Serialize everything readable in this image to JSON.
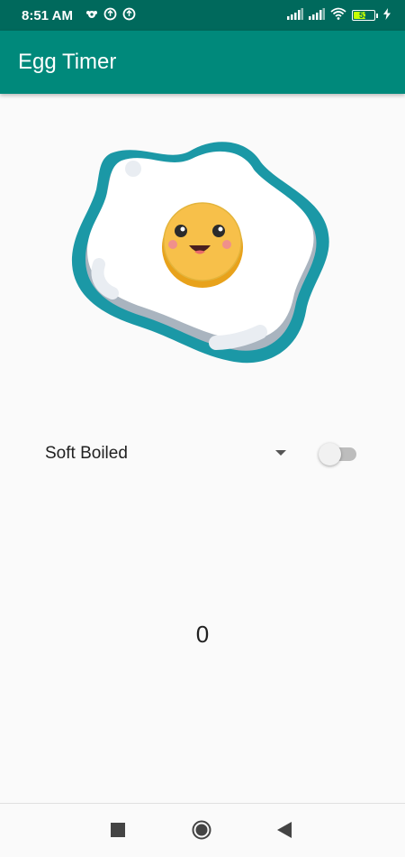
{
  "status_bar": {
    "time": "8:51 AM",
    "battery_level": "53",
    "icons": [
      "notification-icon",
      "sync-icon",
      "sync-icon",
      "signal-icon",
      "signal-icon",
      "wifi-icon",
      "battery-icon",
      "charging-icon"
    ]
  },
  "app_bar": {
    "title": "Egg Timer"
  },
  "egg_image": {
    "description_icon": "egg-illustration"
  },
  "spinner": {
    "selected": "Soft Boiled"
  },
  "switch": {
    "state": "off"
  },
  "timer": {
    "value": "0"
  },
  "nav_bar": {
    "buttons": [
      "recents-button",
      "home-button",
      "back-button"
    ]
  },
  "colors": {
    "status_bar": "#00695c",
    "app_bar": "#00897b",
    "egg_outline": "#1b98a6",
    "yolk": "#f5b62e"
  }
}
